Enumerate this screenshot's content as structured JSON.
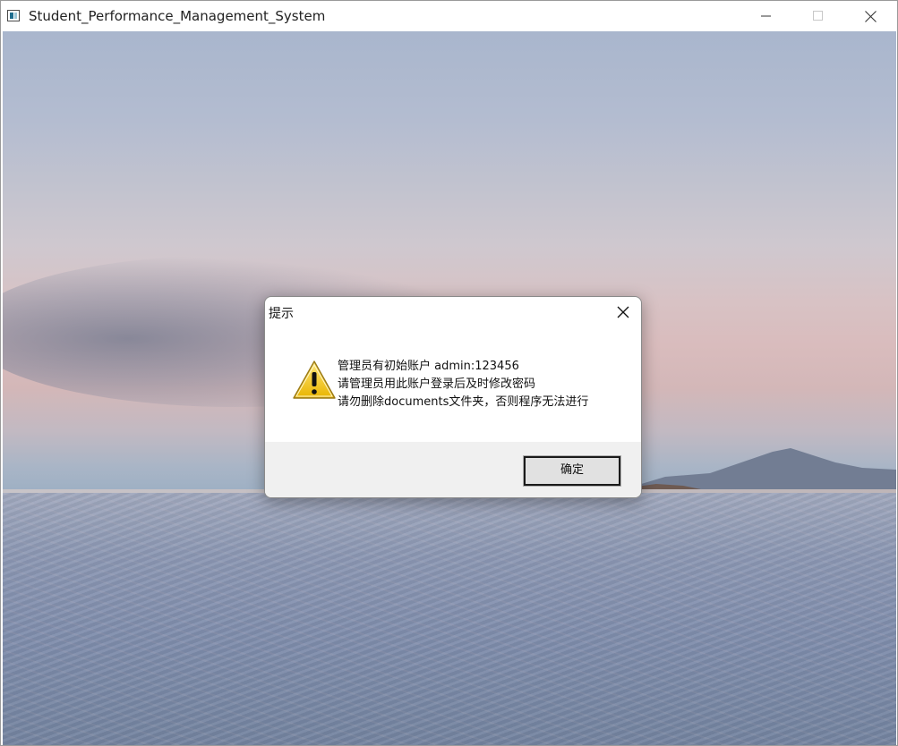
{
  "window": {
    "title": "Student_Performance_Management_System"
  },
  "dialog": {
    "title": "提示",
    "icon": "warning-icon",
    "messages": [
      "管理员有初始账户 admin:123456",
      "请管理员用此账户登录后及时修改密码",
      "请勿删除documents文件夹，否则程序无法进行"
    ],
    "ok_label": "确定"
  },
  "colors": {
    "warning_yellow": "#f2c200",
    "dialog_footer": "#f0f0f0"
  }
}
